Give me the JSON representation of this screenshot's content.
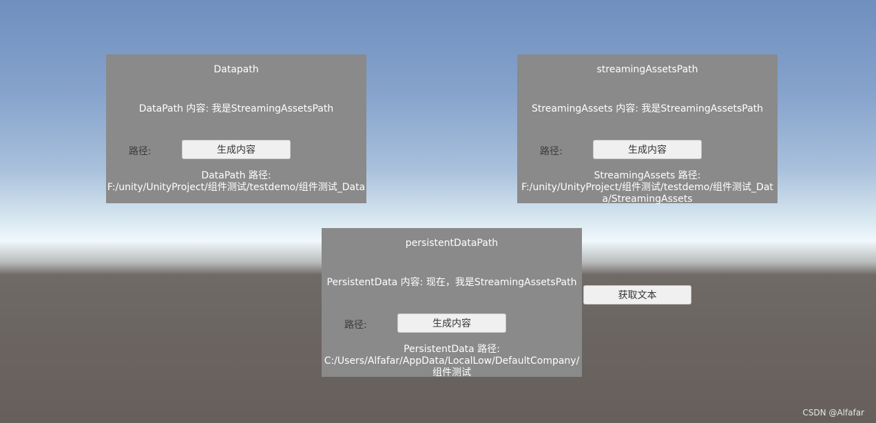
{
  "panels": {
    "datapath": {
      "title": "Datapath",
      "content": "DataPath 内容: 我是StreamingAssetsPath",
      "path_label": "路径:",
      "button_label": "生成内容",
      "path_line1": "DataPath 路径:",
      "path_line2": "F:/unity/UnityProject/组件测试/testdemo/组件测试_Data"
    },
    "streaming": {
      "title": "streamingAssetsPath",
      "content": "StreamingAssets 内容: 我是StreamingAssetsPath",
      "path_label": "路径:",
      "button_label": "生成内容",
      "path_line1": "StreamingAssets 路径:",
      "path_line2": "F:/unity/UnityProject/组件测试/testdemo/组件测试_Data/StreamingAssets"
    },
    "persistent": {
      "title": "persistentDataPath",
      "content": "PersistentData 内容: 现在，我是StreamingAssetsPath",
      "path_label": "路径:",
      "button_label": "生成内容",
      "path_line1": "PersistentData 路径:",
      "path_line2": "C:/Users/Alfafar/AppData/LocalLow/DefaultCompany/组件测试"
    }
  },
  "fetch_button_label": "获取文本",
  "watermark": "CSDN @Alfafar"
}
